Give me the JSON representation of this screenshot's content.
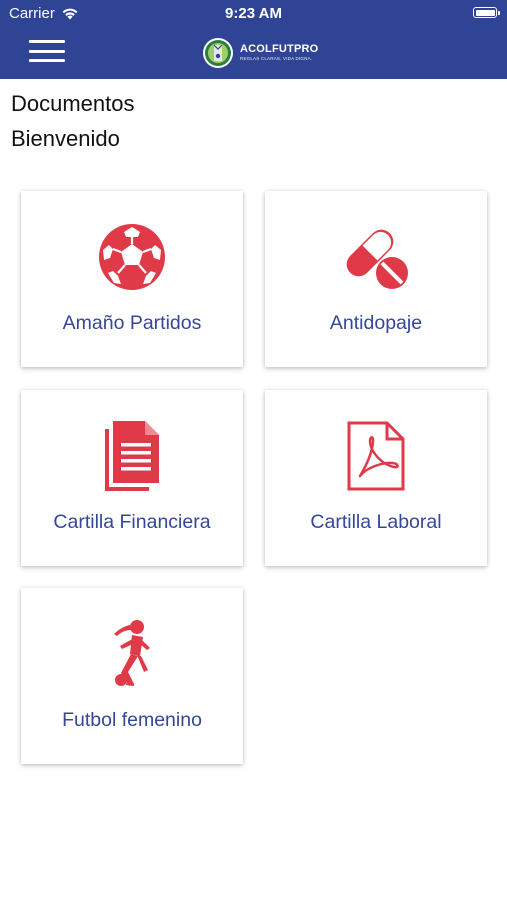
{
  "status_bar": {
    "carrier": "Carrier",
    "time": "9:23 AM",
    "wifi_icon": "wifi-icon",
    "battery_icon": "battery-icon"
  },
  "header": {
    "menu_icon": "hamburger-menu-icon",
    "logo_icon": "acolfutpro-logo",
    "brand_name": "ACOLFUTPRO",
    "brand_tagline": "REGLAS CLARAS, VIDA DIGNA."
  },
  "page": {
    "title": "Documentos",
    "subtitle": "Bienvenido"
  },
  "colors": {
    "header_bg": "#2f4494",
    "icon_red": "#e03a48",
    "label_blue": "#34479a"
  },
  "cards": [
    {
      "label": "Amaño Partidos",
      "icon": "soccer-ball-icon"
    },
    {
      "label": "Antidopaje",
      "icon": "pill-icon"
    },
    {
      "label": "Cartilla Financiera",
      "icon": "document-icon"
    },
    {
      "label": "Cartilla Laboral",
      "icon": "pdf-file-icon"
    },
    {
      "label": "Futbol femenino",
      "icon": "female-soccer-player-icon"
    }
  ]
}
